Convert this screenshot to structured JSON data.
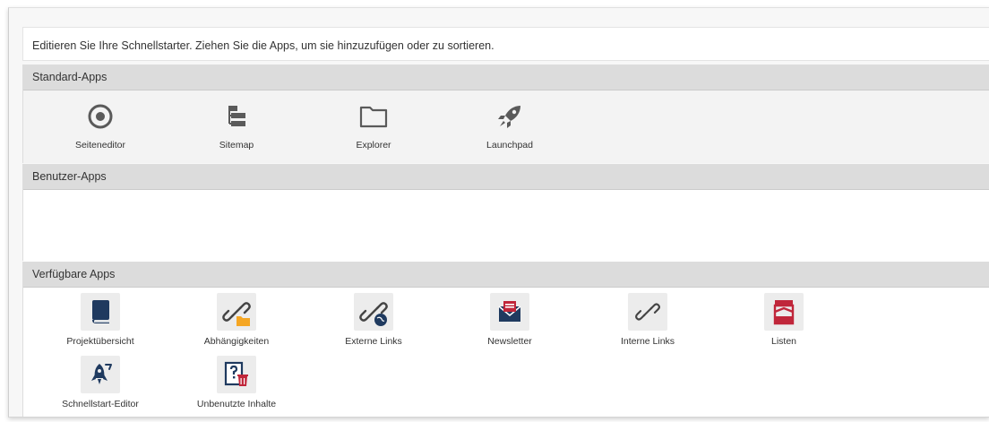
{
  "instruction": "Editieren Sie Ihre Schnellstarter. Ziehen Sie die Apps, um sie hinzuzufügen oder zu sortieren.",
  "sections": {
    "standard": {
      "title": "Standard-Apps",
      "apps": [
        {
          "label": "Seiteneditor",
          "icon": "target-icon"
        },
        {
          "label": "Sitemap",
          "icon": "sitemap-icon"
        },
        {
          "label": "Explorer",
          "icon": "folder-icon"
        },
        {
          "label": "Launchpad",
          "icon": "rocket-icon"
        }
      ]
    },
    "user": {
      "title": "Benutzer-Apps"
    },
    "available": {
      "title": "Verfügbare Apps",
      "apps": [
        {
          "label": "Projektübersicht",
          "icon": "book-icon"
        },
        {
          "label": "Abhängigkeiten",
          "icon": "link-folder-icon"
        },
        {
          "label": "Externe Links",
          "icon": "link-globe-icon"
        },
        {
          "label": "Newsletter",
          "icon": "newsletter-icon"
        },
        {
          "label": "Interne Links",
          "icon": "link-icon"
        },
        {
          "label": "Listen",
          "icon": "list-icon"
        },
        {
          "label": "Schnellstart-Editor",
          "icon": "rocket-edit-icon"
        },
        {
          "label": "Unbenutzte Inhalte",
          "icon": "unused-content-icon"
        }
      ]
    }
  },
  "colors": {
    "icon_gray": "#5a5a5a",
    "icon_navy": "#1f3a5f",
    "icon_red": "#c0263a",
    "folder_orange": "#f5a623",
    "header_bg": "#dcdcdc"
  }
}
